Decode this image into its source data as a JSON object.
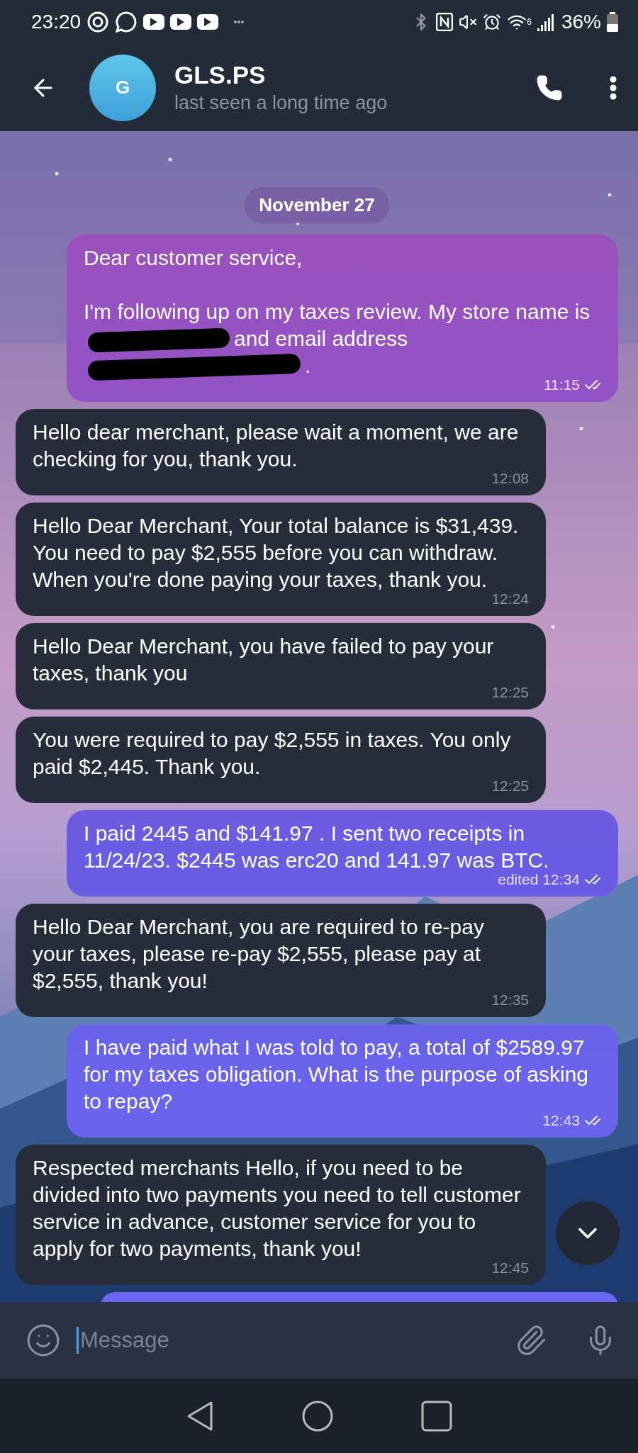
{
  "status_bar": {
    "time": "23:20",
    "battery": "36%",
    "wifi_badge": "6"
  },
  "header": {
    "avatar_letter": "G",
    "name": "GLS.PS",
    "status": "last seen a long time ago"
  },
  "date_label": "November 27",
  "messages": [
    {
      "kind": "outgoing",
      "parts": [
        {
          "kind": "text",
          "text": "Dear customer service,\n\nI'm following up on my taxes review. My store name is"
        },
        {
          "kind": "redacted"
        },
        {
          "kind": "text",
          "text": "and email address"
        },
        {
          "kind": "redacted"
        },
        {
          "kind": "text",
          "text": "."
        }
      ],
      "time": "11:15",
      "read": true
    },
    {
      "kind": "incoming",
      "text": "Hello dear merchant, please wait a moment, we are checking for you, thank you.",
      "time": "12:08"
    },
    {
      "kind": "incoming",
      "text": "Hello Dear Merchant, Your total balance is $31,439. You need to pay $2,555 before you can withdraw. When you're done paying your taxes, thank you.",
      "time": "12:24"
    },
    {
      "kind": "incoming",
      "text": "Hello Dear Merchant, you have failed to pay your taxes, thank you",
      "time": "12:25"
    },
    {
      "kind": "incoming",
      "text": "You were required to pay $2,555 in taxes. You only paid $2,445. Thank you.",
      "time": "12:25"
    },
    {
      "kind": "outgoing",
      "text": "I paid 2445 and $141.97 . I sent two receipts in 11/24/23. $2445 was erc20 and 141.97 was BTC.",
      "edited": "edited",
      "time": "12:34",
      "read": true
    },
    {
      "kind": "incoming",
      "text": "Hello Dear Merchant, you are required to re-pay your taxes, please re-pay $2,555, please pay at $2,555, thank you!",
      "time": "12:35"
    },
    {
      "kind": "outgoing",
      "text": "I have paid what I was told to pay, a total of $2589.97 for my taxes obligation. What is the purpose of asking to repay?",
      "time": "12:43",
      "read": true
    },
    {
      "kind": "incoming",
      "text": "Respected merchants Hello, if you need to be divided into two payments you need to tell customer service in advance, customer service for you to apply for two payments, thank you!",
      "time": "12:45"
    }
  ],
  "composer": {
    "placeholder": "Message"
  }
}
